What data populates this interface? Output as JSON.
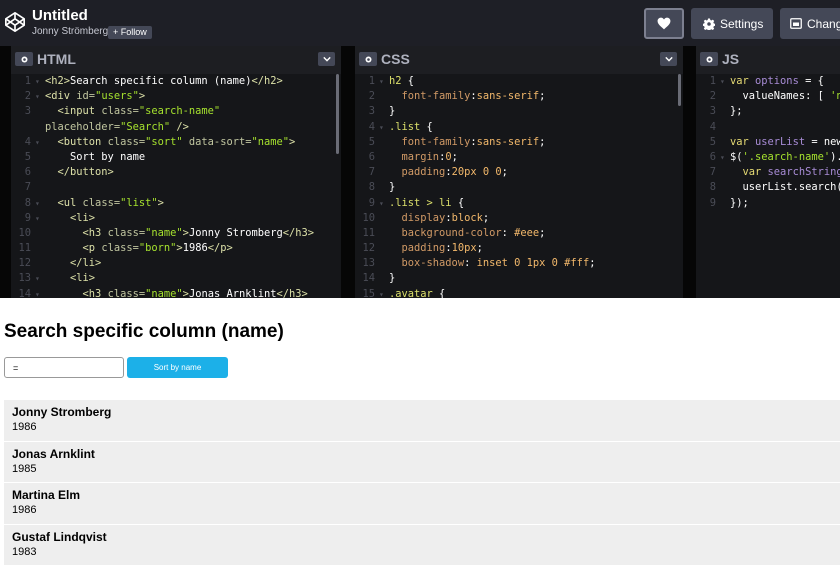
{
  "header": {
    "title": "Untitled",
    "author": "Jonny Strömberg",
    "follow_label": "+ Follow",
    "settings_label": "Settings",
    "change_label": "Change"
  },
  "editors": [
    {
      "title": "HTML",
      "lines": [
        [
          [
            "t-tag",
            "<h2>"
          ],
          [
            "t-plain",
            "Search specific column (name)"
          ],
          [
            "t-tag",
            "</h2>"
          ]
        ],
        [
          [
            "t-tag",
            "<div "
          ],
          [
            "t-attr",
            "id="
          ],
          [
            "t-str",
            "\"users\""
          ],
          [
            "t-tag",
            ">"
          ]
        ],
        [
          [
            "t-plain",
            "  "
          ],
          [
            "t-tag",
            "<input "
          ],
          [
            "t-attr",
            "class="
          ],
          [
            "t-str",
            "\"search-name\""
          ]
        ],
        [
          [
            "t-attr",
            "placeholder="
          ],
          [
            "t-str",
            "\"Search\""
          ],
          [
            "t-tag",
            " />"
          ]
        ],
        [
          [
            "t-plain",
            "  "
          ],
          [
            "t-tag",
            "<button "
          ],
          [
            "t-attr",
            "class="
          ],
          [
            "t-str",
            "\"sort\""
          ],
          [
            "t-attr",
            " data-sort="
          ],
          [
            "t-str",
            "\"name\""
          ],
          [
            "t-tag",
            ">"
          ]
        ],
        [
          [
            "t-plain",
            "    Sort by name"
          ]
        ],
        [
          [
            "t-plain",
            "  "
          ],
          [
            "t-tag",
            "</button>"
          ]
        ],
        [
          [
            "t-plain",
            ""
          ]
        ],
        [
          [
            "t-plain",
            "  "
          ],
          [
            "t-tag",
            "<ul "
          ],
          [
            "t-attr",
            "class="
          ],
          [
            "t-str",
            "\"list\""
          ],
          [
            "t-tag",
            ">"
          ]
        ],
        [
          [
            "t-plain",
            "    "
          ],
          [
            "t-tag",
            "<li>"
          ]
        ],
        [
          [
            "t-plain",
            "      "
          ],
          [
            "t-tag",
            "<h3 "
          ],
          [
            "t-attr",
            "class="
          ],
          [
            "t-str",
            "\"name\""
          ],
          [
            "t-tag",
            ">"
          ],
          [
            "t-plain",
            "Jonny Stromberg"
          ],
          [
            "t-tag",
            "</h3>"
          ]
        ],
        [
          [
            "t-plain",
            "      "
          ],
          [
            "t-tag",
            "<p "
          ],
          [
            "t-attr",
            "class="
          ],
          [
            "t-str",
            "\"born\""
          ],
          [
            "t-tag",
            ">"
          ],
          [
            "t-plain",
            "1986"
          ],
          [
            "t-tag",
            "</p>"
          ]
        ],
        [
          [
            "t-plain",
            "    "
          ],
          [
            "t-tag",
            "</li>"
          ]
        ],
        [
          [
            "t-plain",
            "    "
          ],
          [
            "t-tag",
            "<li>"
          ]
        ],
        [
          [
            "t-plain",
            "      "
          ],
          [
            "t-tag",
            "<h3 "
          ],
          [
            "t-attr",
            "class="
          ],
          [
            "t-str",
            "\"name\""
          ],
          [
            "t-tag",
            ">"
          ],
          [
            "t-plain",
            "Jonas Arnklint"
          ],
          [
            "t-tag",
            "</h3>"
          ]
        ]
      ],
      "line_numbers": [
        "1",
        "2",
        "3",
        "",
        "4",
        "5",
        "6",
        "7",
        "8",
        "9",
        "10",
        "11",
        "12",
        "13",
        "14"
      ],
      "folds": [
        "▾",
        "▾",
        "",
        "",
        "▾",
        "",
        "",
        "",
        "▾",
        "▾",
        "",
        "",
        "",
        "▾",
        "▾"
      ]
    },
    {
      "title": "CSS",
      "lines": [
        [
          [
            "t-sel",
            "h2 "
          ],
          [
            "t-plain",
            "{"
          ]
        ],
        [
          [
            "t-plain",
            "  "
          ],
          [
            "t-prop",
            "font-family"
          ],
          [
            "t-plain",
            ":"
          ],
          [
            "t-val",
            "sans-serif"
          ],
          [
            "t-plain",
            ";"
          ]
        ],
        [
          [
            "t-plain",
            "}"
          ]
        ],
        [
          [
            "t-sel",
            ".list "
          ],
          [
            "t-plain",
            "{"
          ]
        ],
        [
          [
            "t-plain",
            "  "
          ],
          [
            "t-prop",
            "font-family"
          ],
          [
            "t-plain",
            ":"
          ],
          [
            "t-val",
            "sans-serif"
          ],
          [
            "t-plain",
            ";"
          ]
        ],
        [
          [
            "t-plain",
            "  "
          ],
          [
            "t-prop",
            "margin"
          ],
          [
            "t-plain",
            ":"
          ],
          [
            "t-val",
            "0"
          ],
          [
            "t-plain",
            ";"
          ]
        ],
        [
          [
            "t-plain",
            "  "
          ],
          [
            "t-prop",
            "padding"
          ],
          [
            "t-plain",
            ":"
          ],
          [
            "t-val",
            "20px 0 0"
          ],
          [
            "t-plain",
            ";"
          ]
        ],
        [
          [
            "t-plain",
            "}"
          ]
        ],
        [
          [
            "t-sel",
            ".list > li "
          ],
          [
            "t-plain",
            "{"
          ]
        ],
        [
          [
            "t-plain",
            "  "
          ],
          [
            "t-prop",
            "display"
          ],
          [
            "t-plain",
            ":"
          ],
          [
            "t-val",
            "block"
          ],
          [
            "t-plain",
            ";"
          ]
        ],
        [
          [
            "t-plain",
            "  "
          ],
          [
            "t-prop",
            "background-color"
          ],
          [
            "t-plain",
            ": "
          ],
          [
            "t-val",
            "#eee"
          ],
          [
            "t-plain",
            ";"
          ]
        ],
        [
          [
            "t-plain",
            "  "
          ],
          [
            "t-prop",
            "padding"
          ],
          [
            "t-plain",
            ":"
          ],
          [
            "t-val",
            "10px"
          ],
          [
            "t-plain",
            ";"
          ]
        ],
        [
          [
            "t-plain",
            "  "
          ],
          [
            "t-prop",
            "box-shadow"
          ],
          [
            "t-plain",
            ": "
          ],
          [
            "t-val",
            "inset 0 1px 0 #fff"
          ],
          [
            "t-plain",
            ";"
          ]
        ],
        [
          [
            "t-plain",
            "}"
          ]
        ],
        [
          [
            "t-sel",
            ".avatar "
          ],
          [
            "t-plain",
            "{"
          ]
        ]
      ],
      "line_numbers": [
        "1",
        "2",
        "3",
        "4",
        "5",
        "6",
        "7",
        "8",
        "9",
        "10",
        "11",
        "12",
        "13",
        "14",
        "15"
      ],
      "folds": [
        "▾",
        "",
        "",
        "▾",
        "",
        "",
        "",
        "",
        "▾",
        "",
        "",
        "",
        "",
        "",
        "▾"
      ]
    },
    {
      "title": "JS",
      "lines": [
        [
          [
            "t-kw",
            "var "
          ],
          [
            "t-var",
            "options"
          ],
          [
            "t-plain",
            " = {"
          ]
        ],
        [
          [
            "t-plain",
            "  valueNames: [ "
          ],
          [
            "t-str",
            "'na"
          ]
        ],
        [
          [
            "t-plain",
            "};"
          ]
        ],
        [
          [
            "t-plain",
            ""
          ]
        ],
        [
          [
            "t-kw",
            "var "
          ],
          [
            "t-var",
            "userList"
          ],
          [
            "t-plain",
            " = new"
          ]
        ],
        [
          [
            "t-plain",
            "$("
          ],
          [
            "t-str",
            "'.search-name'"
          ],
          [
            "t-plain",
            ").o"
          ]
        ],
        [
          [
            "t-plain",
            "  "
          ],
          [
            "t-kw",
            "var "
          ],
          [
            "t-var",
            "searchString"
          ]
        ],
        [
          [
            "t-plain",
            "  userList.search(s"
          ]
        ],
        [
          [
            "t-plain",
            "});"
          ]
        ]
      ],
      "line_numbers": [
        "1",
        "2",
        "3",
        "4",
        "5",
        "6",
        "7",
        "8",
        "9"
      ],
      "folds": [
        "▾",
        "",
        "",
        "",
        "",
        "▾",
        "",
        "",
        ""
      ]
    }
  ],
  "result": {
    "heading": "Search specific column (name)",
    "search_value": "=",
    "sort_label": "Sort by name",
    "items": [
      {
        "name": "Jonny Stromberg",
        "born": "1986"
      },
      {
        "name": "Jonas Arnklint",
        "born": "1985"
      },
      {
        "name": "Martina Elm",
        "born": "1986"
      },
      {
        "name": "Gustaf Lindqvist",
        "born": "1983"
      }
    ]
  }
}
